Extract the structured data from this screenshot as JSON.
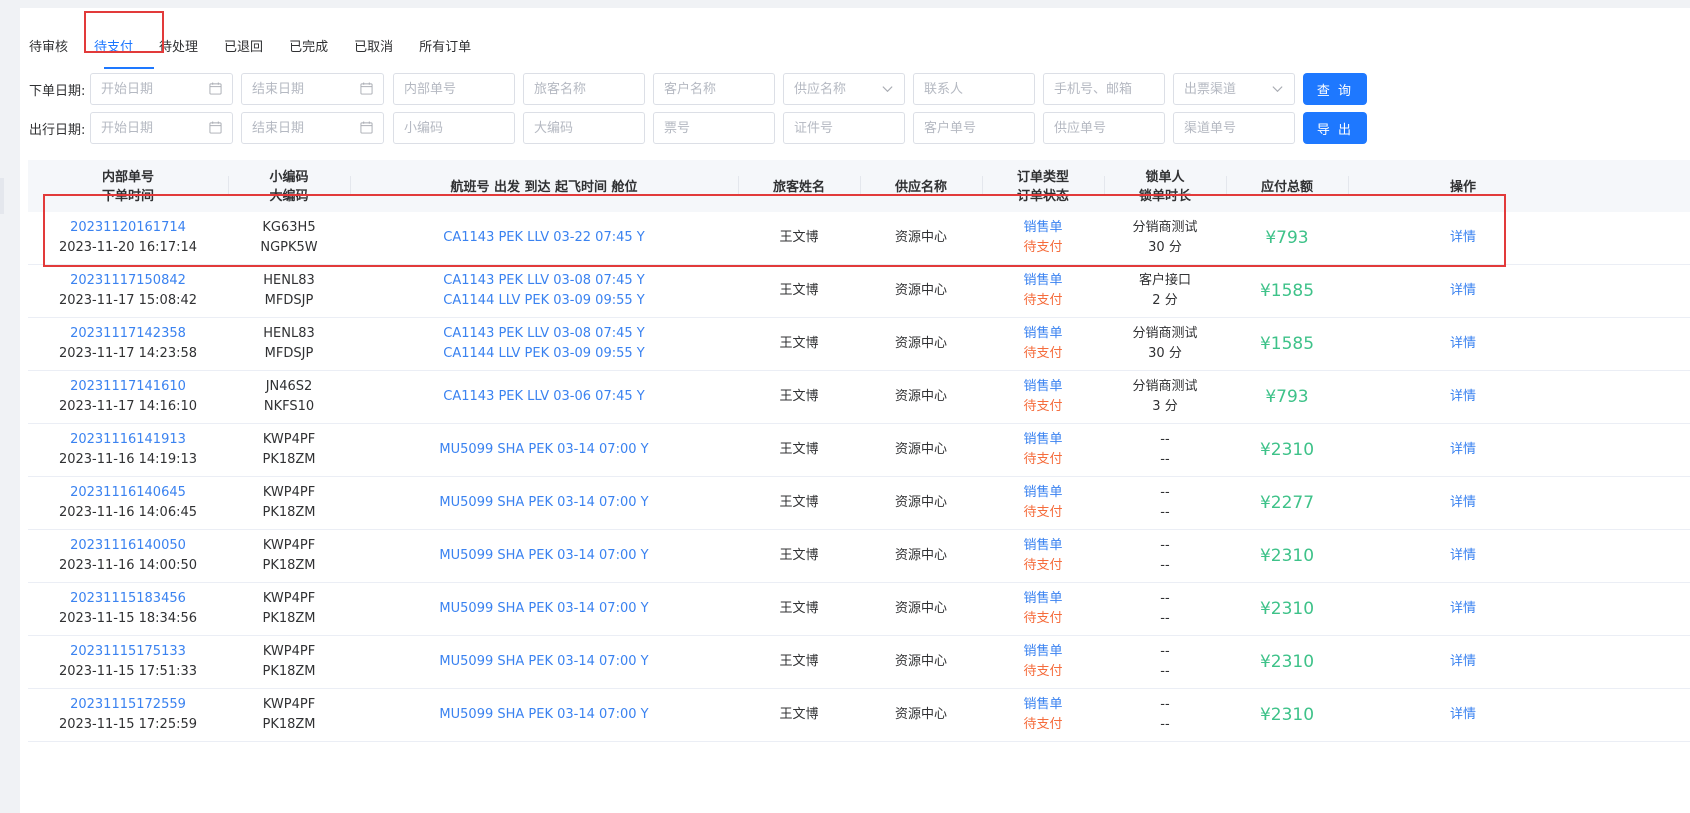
{
  "tabs": [
    "待审核",
    "待支付",
    "待处理",
    "已退回",
    "已完成",
    "已取消",
    "所有订单"
  ],
  "active_tab": 1,
  "filters": {
    "order_date_label": "下单日期:",
    "travel_date_label": "出行日期:",
    "row1": {
      "start_date": "开始日期",
      "end_date": "结束日期",
      "internal_no": "内部单号",
      "passenger": "旅客名称",
      "customer": "客户名称",
      "supplier": "供应名称",
      "contact": "联系人",
      "phone_email": "手机号、邮箱",
      "channel": "出票渠道"
    },
    "row2": {
      "start_date": "开始日期",
      "end_date": "结束日期",
      "small_code": "小编码",
      "big_code": "大编码",
      "ticket_no": "票号",
      "id_no": "证件号",
      "customer_no": "客户单号",
      "supplier_no": "供应单号",
      "channel_no": "渠道单号"
    },
    "query_button": "查 询",
    "export_button": "导 出"
  },
  "table": {
    "headers": {
      "col1_l1": "内部单号",
      "col1_l2": "下单时间",
      "col2_l1": "小编码",
      "col2_l2": "大编码",
      "col3": "航班号 出发 到达 起飞时间 舱位",
      "col4": "旅客姓名",
      "col5": "供应名称",
      "col6_l1": "订单类型",
      "col6_l2": "订单状态",
      "col7_l1": "锁单人",
      "col7_l2": "锁单时长",
      "col8": "应付总额",
      "col9": "操作"
    },
    "rows": [
      {
        "order_no": "20231120161714",
        "time": "2023-11-20 16:17:14",
        "small": "KG63H5",
        "big": "NGPK5W",
        "f1": "CA1143 PEK LLV 03-22 07:45 Y",
        "f2": "",
        "pax": "王文博",
        "supplier": "资源中心",
        "type": "销售单",
        "status": "待支付",
        "lock1": "分销商测试",
        "lock2": "30 分",
        "amount": "¥793",
        "action": "详情"
      },
      {
        "order_no": "20231117150842",
        "time": "2023-11-17 15:08:42",
        "small": "HENL83",
        "big": "MFDSJP",
        "f1": "CA1143 PEK LLV 03-08 07:45 Y",
        "f2": "CA1144 LLV PEK 03-09 09:55 Y",
        "pax": "王文博",
        "supplier": "资源中心",
        "type": "销售单",
        "status": "待支付",
        "lock1": "客户接口",
        "lock2": "2 分",
        "amount": "¥1585",
        "action": "详情"
      },
      {
        "order_no": "20231117142358",
        "time": "2023-11-17 14:23:58",
        "small": "HENL83",
        "big": "MFDSJP",
        "f1": "CA1143 PEK LLV 03-08 07:45 Y",
        "f2": "CA1144 LLV PEK 03-09 09:55 Y",
        "pax": "王文博",
        "supplier": "资源中心",
        "type": "销售单",
        "status": "待支付",
        "lock1": "分销商测试",
        "lock2": "30 分",
        "amount": "¥1585",
        "action": "详情"
      },
      {
        "order_no": "20231117141610",
        "time": "2023-11-17 14:16:10",
        "small": "JN46S2",
        "big": "NKFS10",
        "f1": "CA1143 PEK LLV 03-06 07:45 Y",
        "f2": "",
        "pax": "王文博",
        "supplier": "资源中心",
        "type": "销售单",
        "status": "待支付",
        "lock1": "分销商测试",
        "lock2": "3 分",
        "amount": "¥793",
        "action": "详情"
      },
      {
        "order_no": "20231116141913",
        "time": "2023-11-16 14:19:13",
        "small": "KWP4PF",
        "big": "PK18ZM",
        "f1": "MU5099 SHA PEK 03-14 07:00 Y",
        "f2": "",
        "pax": "王文博",
        "supplier": "资源中心",
        "type": "销售单",
        "status": "待支付",
        "lock1": "--",
        "lock2": "--",
        "amount": "¥2310",
        "action": "详情"
      },
      {
        "order_no": "20231116140645",
        "time": "2023-11-16 14:06:45",
        "small": "KWP4PF",
        "big": "PK18ZM",
        "f1": "MU5099 SHA PEK 03-14 07:00 Y",
        "f2": "",
        "pax": "王文博",
        "supplier": "资源中心",
        "type": "销售单",
        "status": "待支付",
        "lock1": "--",
        "lock2": "--",
        "amount": "¥2277",
        "action": "详情"
      },
      {
        "order_no": "20231116140050",
        "time": "2023-11-16 14:00:50",
        "small": "KWP4PF",
        "big": "PK18ZM",
        "f1": "MU5099 SHA PEK 03-14 07:00 Y",
        "f2": "",
        "pax": "王文博",
        "supplier": "资源中心",
        "type": "销售单",
        "status": "待支付",
        "lock1": "--",
        "lock2": "--",
        "amount": "¥2310",
        "action": "详情"
      },
      {
        "order_no": "20231115183456",
        "time": "2023-11-15 18:34:56",
        "small": "KWP4PF",
        "big": "PK18ZM",
        "f1": "MU5099 SHA PEK 03-14 07:00 Y",
        "f2": "",
        "pax": "王文博",
        "supplier": "资源中心",
        "type": "销售单",
        "status": "待支付",
        "lock1": "--",
        "lock2": "--",
        "amount": "¥2310",
        "action": "详情"
      },
      {
        "order_no": "20231115175133",
        "time": "2023-11-15 17:51:33",
        "small": "KWP4PF",
        "big": "PK18ZM",
        "f1": "MU5099 SHA PEK 03-14 07:00 Y",
        "f2": "",
        "pax": "王文博",
        "supplier": "资源中心",
        "type": "销售单",
        "status": "待支付",
        "lock1": "--",
        "lock2": "--",
        "amount": "¥2310",
        "action": "详情"
      },
      {
        "order_no": "20231115172559",
        "time": "2023-11-15 17:25:59",
        "small": "KWP4PF",
        "big": "PK18ZM",
        "f1": "MU5099 SHA PEK 03-14 07:00 Y",
        "f2": "",
        "pax": "王文博",
        "supplier": "资源中心",
        "type": "销售单",
        "status": "待支付",
        "lock1": "--",
        "lock2": "--",
        "amount": "¥2310",
        "action": "详情"
      }
    ]
  },
  "colors": {
    "accent": "#1e78ff",
    "link": "#3a82f0",
    "status": "#f56c3c",
    "amount": "#3ec289",
    "highlight": "#e23a3a"
  },
  "icons": {
    "date": "calendar-icon",
    "select": "chevron-down-icon"
  }
}
